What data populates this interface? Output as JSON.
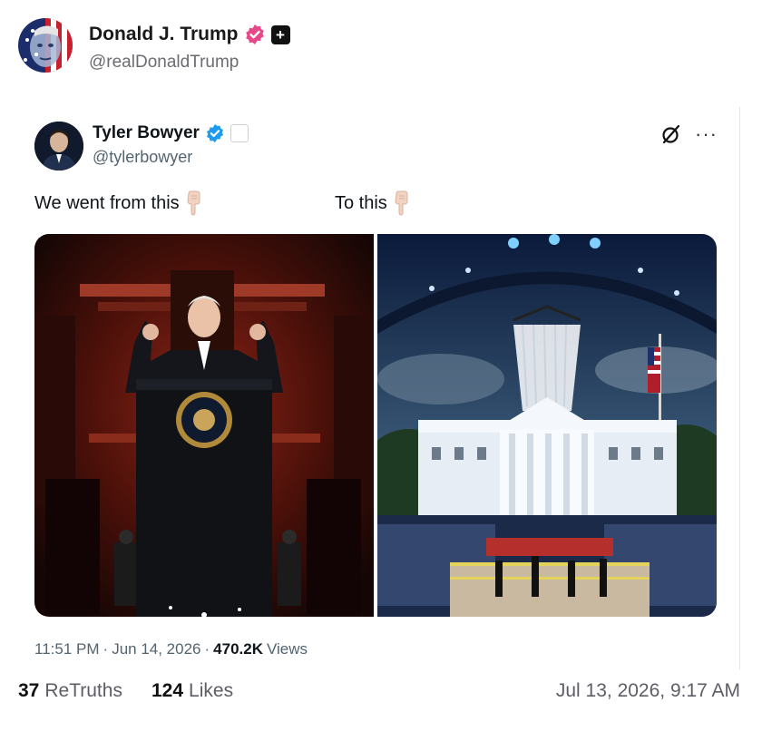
{
  "post": {
    "author_name": "Donald J. Trump",
    "author_handle": "@realDonaldTrump",
    "avatar_icon": "flag-face-avatar",
    "verified_icon": "pink-verified-badge-icon",
    "plus_icon": "plus-badge-icon"
  },
  "quote": {
    "author_name": "Tyler Bowyer",
    "author_handle": "@tylerbowyer",
    "verified_icon": "blue-verified-badge-icon",
    "affiliate_icon": "affiliate-badge-icon",
    "grok_icon": "grok-icon",
    "more_label": "···",
    "text_left": "We went from this",
    "text_right": "To this",
    "pointing_icon": "pointing-down-emoji",
    "time": "11:51 PM",
    "date": "Jun 14, 2026",
    "separator": "·",
    "views_count": "470.2K",
    "views_label": "Views",
    "images": [
      {
        "name": "image-biden-speech-red-backdrop"
      },
      {
        "name": "image-white-house-flyover-event"
      }
    ]
  },
  "footer": {
    "retruths_count": "37",
    "retruths_label": "ReTruths",
    "likes_count": "124",
    "likes_label": "Likes",
    "post_date": "Jul 13, 2026, 9:17 AM"
  },
  "colors": {
    "verified_pink": "#e8488a",
    "verified_blue": "#1d9bf0",
    "muted_text": "#536471"
  }
}
